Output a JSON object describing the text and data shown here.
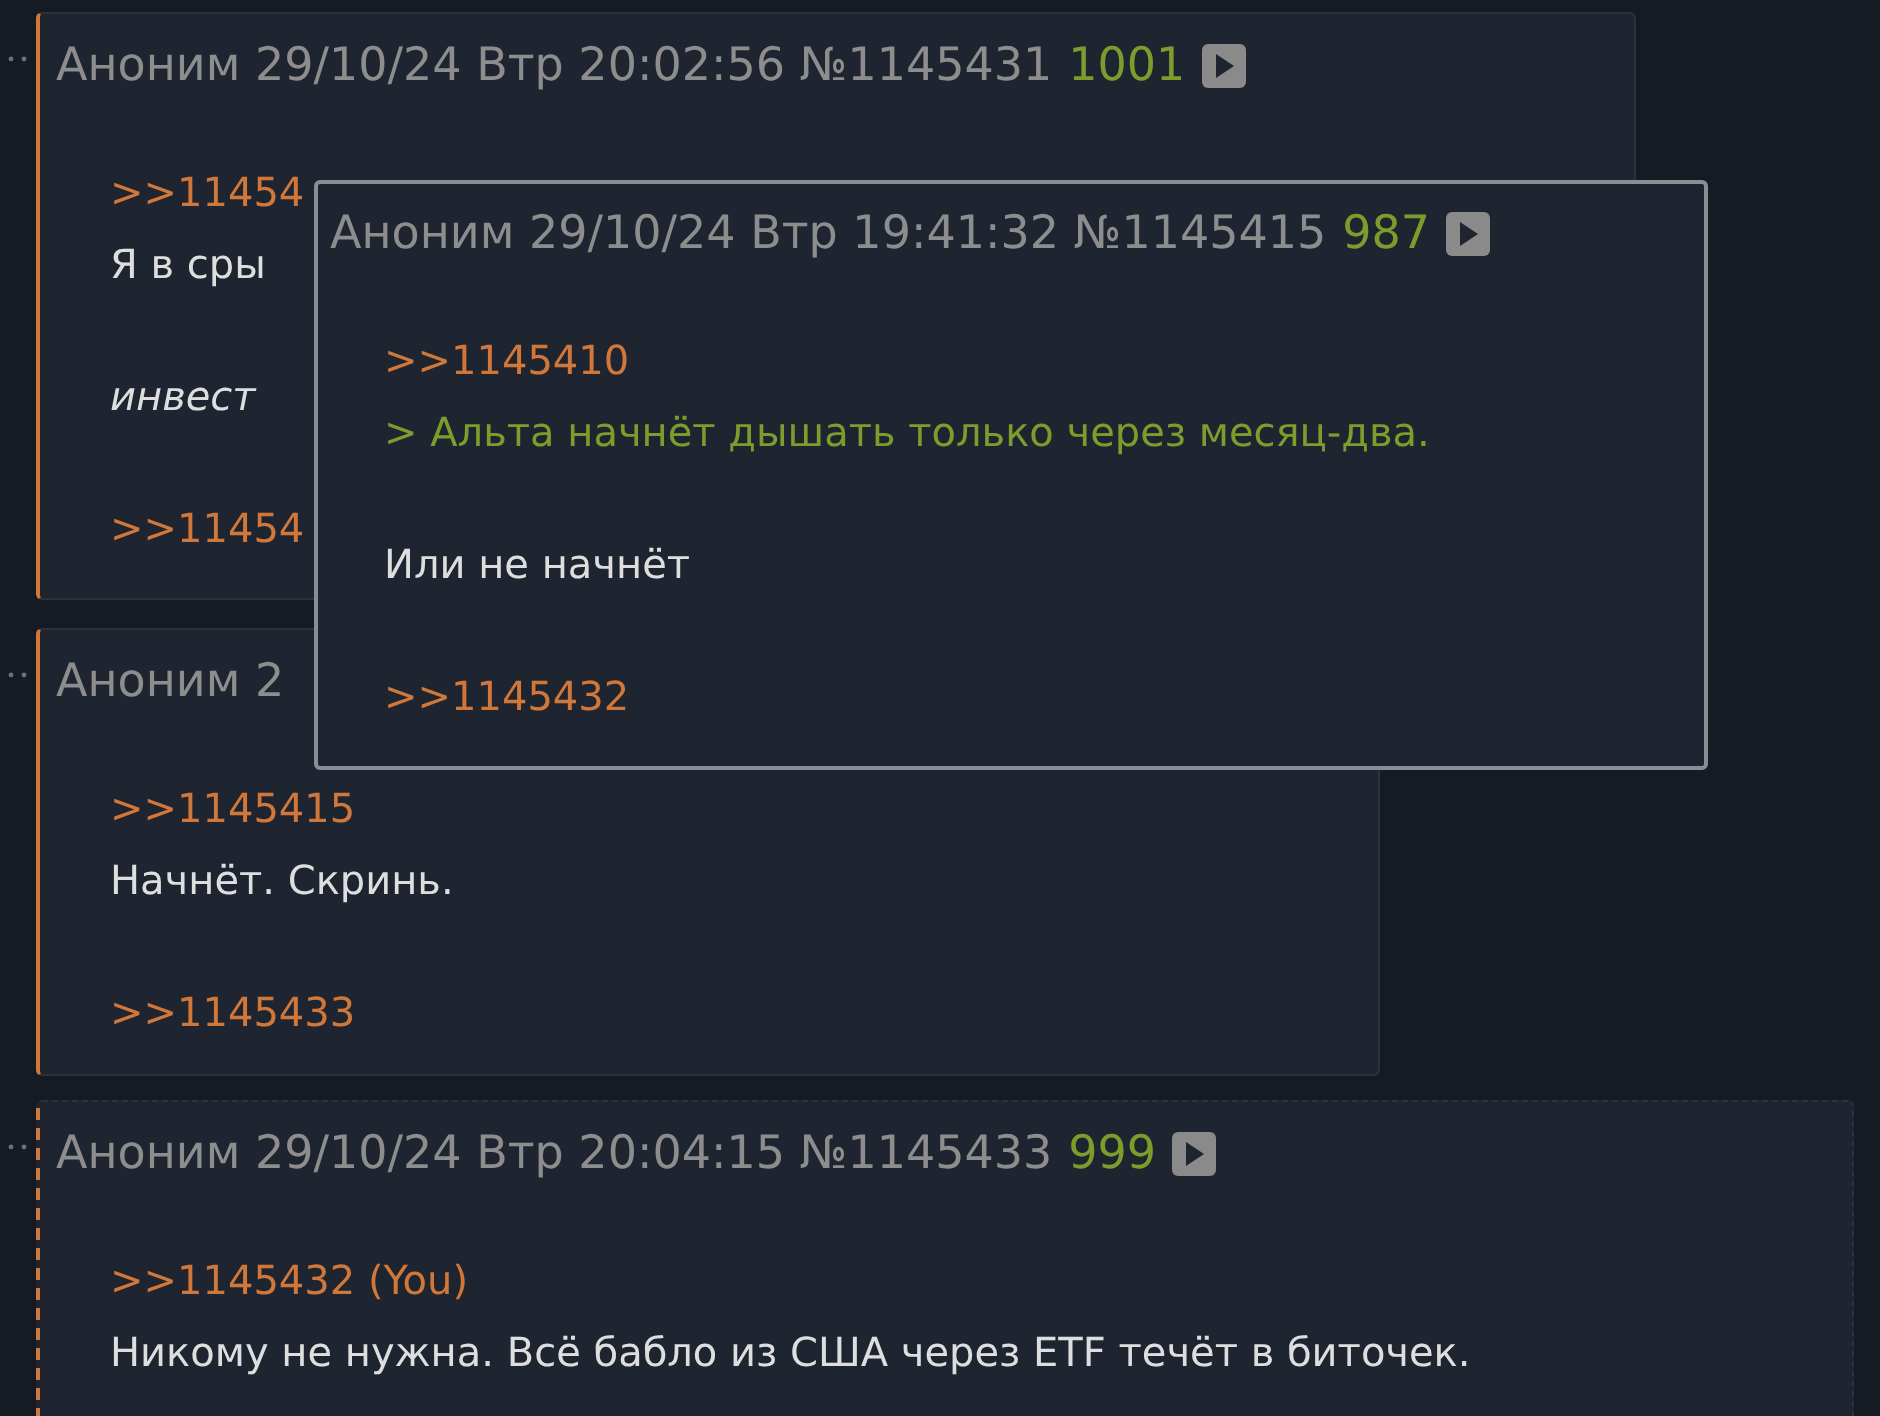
{
  "posts": [
    {
      "dashed_border": false,
      "header": {
        "author": "Аноним",
        "date": "29/10/24",
        "day": "Втр",
        "time": "20:02:56",
        "number": "№1145431",
        "score": "1001"
      },
      "paragraphs": [
        [
          {
            "kind": "link",
            "text": ">>11454"
          },
          {
            "kind": "text",
            "text": "Я в сры"
          }
        ],
        [
          {
            "kind": "italic",
            "text": "инвест"
          }
        ],
        [
          {
            "kind": "link",
            "text": ">>11454"
          }
        ]
      ]
    },
    {
      "dashed_border": false,
      "header": {
        "author": "Аноним",
        "date": "2"
      },
      "paragraphs": [
        [
          {
            "kind": "link",
            "text": ">>1145415"
          },
          {
            "kind": "text",
            "text": "Начнёт. Скринь."
          }
        ],
        [
          {
            "kind": "link",
            "text": ">>1145433"
          }
        ]
      ]
    },
    {
      "dashed_border": true,
      "header": {
        "author": "Аноним",
        "date": "29/10/24",
        "day": "Втр",
        "time": "20:04:15",
        "number": "№1145433",
        "score": "999"
      },
      "paragraphs": [
        [
          {
            "kind": "link",
            "text": ">>1145432 (You)"
          },
          {
            "kind": "text",
            "text": "Никому не нужна. Всё бабло из США через ETF течёт в биточек."
          }
        ]
      ]
    }
  ],
  "popup": {
    "header": {
      "author": "Аноним",
      "date": "29/10/24",
      "day": "Втр",
      "time": "19:41:32",
      "number": "№1145415",
      "score": "987"
    },
    "paragraphs": [
      [
        {
          "kind": "link",
          "text": ">>1145410"
        },
        {
          "kind": "quote",
          "text": "> Альта начнёт дышать только через месяц-два."
        }
      ],
      [
        {
          "kind": "text",
          "text": "Или не начнёт"
        }
      ],
      [
        {
          "kind": "link",
          "text": ">>1145432"
        }
      ]
    ]
  }
}
